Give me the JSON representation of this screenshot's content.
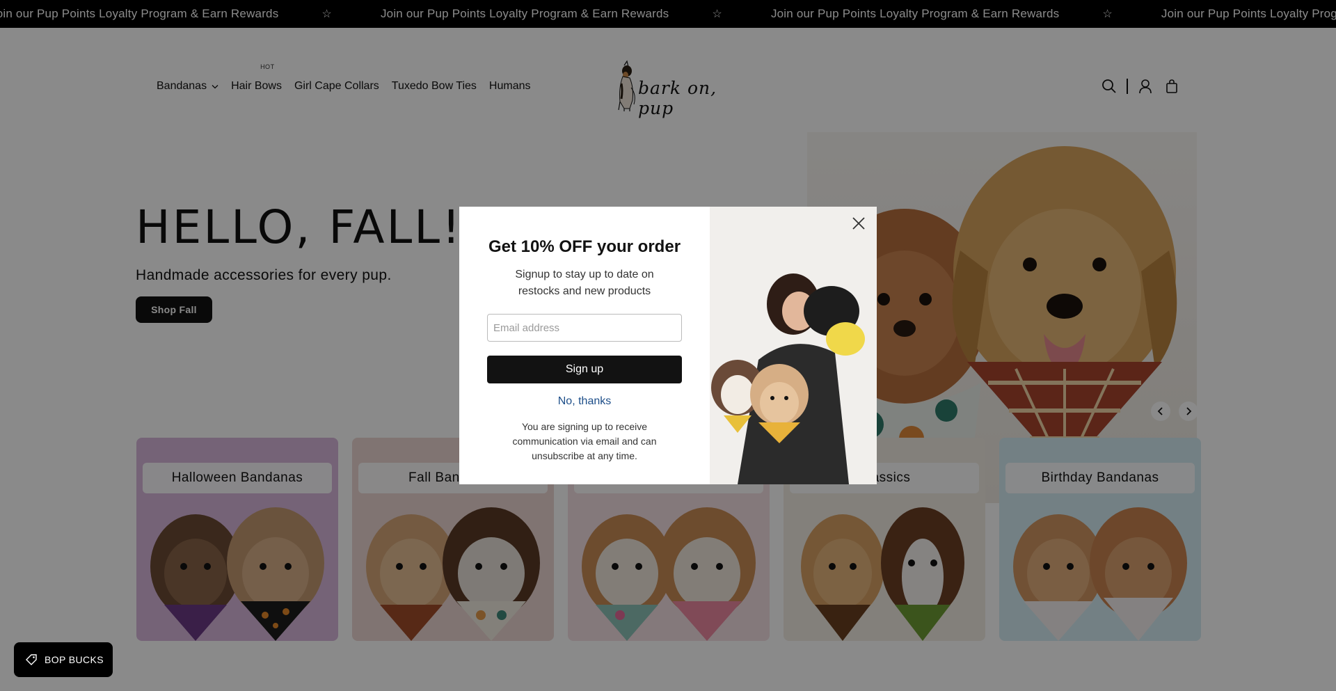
{
  "announcement": {
    "items": [
      "Join our Pup Points Loyalty Program & Earn Rewards",
      "Join our Pup Points Loyalty Program & Earn Rewards",
      "Join our Pup Points Loyalty Program & Earn Rewards",
      "Join our Pup Points Loyalty Program & Earn Rewards"
    ],
    "separator_icon": "star-icon"
  },
  "nav": {
    "bandanas": "Bandanas",
    "hair_bows": "Hair Bows",
    "hair_bows_badge": "HOT",
    "girl_cape_collars": "Girl Cape Collars",
    "tuxedo_bow_ties": "Tuxedo Bow Ties",
    "humans": "Humans"
  },
  "logo": {
    "text": "bark on, pup"
  },
  "header_icons": [
    "search-icon",
    "account-icon",
    "cart-icon"
  ],
  "hero": {
    "title": "HELLO, FALL!",
    "subtitle": "Handmade accessories for every pup.",
    "cta": "Shop Fall"
  },
  "collections": [
    {
      "label": "Halloween Bandanas",
      "color": "#d9b8dc"
    },
    {
      "label": "Fall Bandanas",
      "color": "#ecd6d2"
    },
    {
      "label": "",
      "color": "#f4dfe3"
    },
    {
      "label": "Classics",
      "color": "#f3ece4"
    },
    {
      "label": "Birthday Bandanas",
      "color": "#d4ecf4"
    }
  ],
  "modal": {
    "title": "Get 10% OFF your order",
    "description": "Signup to stay up to date on restocks and new products",
    "email_placeholder": "Email address",
    "email_value": "",
    "signup_label": "Sign up",
    "no_thanks_label": "No, thanks",
    "fine_print": "You are signing up to receive communication via email and can unsubscribe at any time."
  },
  "bop_bucks": {
    "label": "BOP BUCKS"
  },
  "colors": {
    "overlay": "rgba(0,0,0,0.46)",
    "button_dark": "#121212",
    "link_blue": "#1d4e89",
    "announcement_bg": "#000000"
  }
}
